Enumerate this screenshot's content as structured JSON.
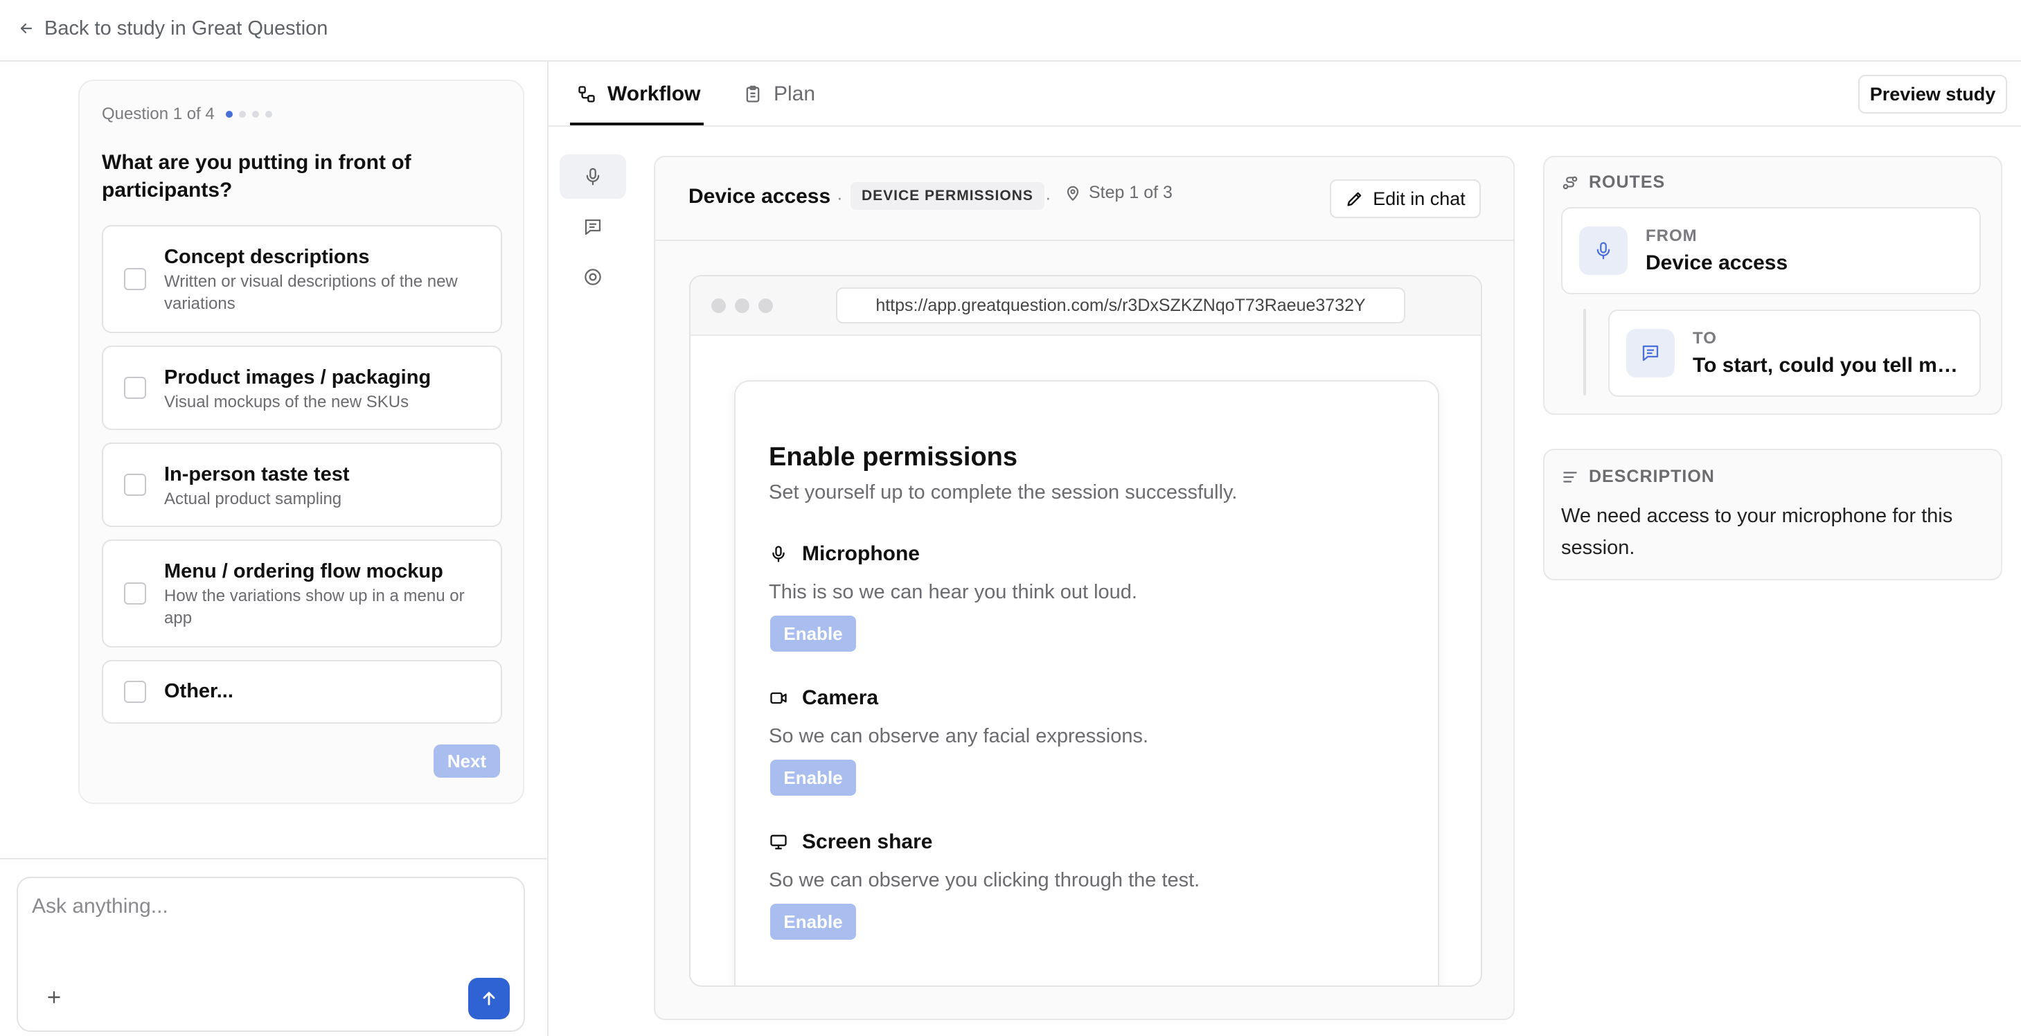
{
  "topbar": {
    "back_label": "Back to study in Great Question",
    "back_icon": "arrow-left-icon"
  },
  "question": {
    "meta": "Question 1 of 4",
    "progress_total": 4,
    "progress_current": 1,
    "text": "What are you putting in front of participants?",
    "options": [
      {
        "title": "Concept descriptions",
        "sub": "Written or visual descriptions of the new variations",
        "checked": false
      },
      {
        "title": "Product images / packaging",
        "sub": "Visual mockups of the new SKUs",
        "checked": false
      },
      {
        "title": "In-person taste test",
        "sub": "Actual product sampling",
        "checked": false
      },
      {
        "title": "Menu / ordering flow mockup",
        "sub": "How the variations show up in a menu or app",
        "checked": false
      },
      {
        "title": "Other...",
        "sub": "",
        "checked": false
      }
    ],
    "next_label": "Next"
  },
  "chat": {
    "placeholder": "Ask anything...",
    "plus_icon": "plus-icon",
    "send_icon": "arrow-up-icon"
  },
  "tabs": [
    {
      "label": "Workflow",
      "icon": "workflow-icon",
      "active": true
    },
    {
      "label": "Plan",
      "icon": "clipboard-icon",
      "active": false
    }
  ],
  "preview_label": "Preview study",
  "rail": [
    {
      "icon": "microphone-icon",
      "active": true
    },
    {
      "icon": "message-icon",
      "active": false
    },
    {
      "icon": "target-icon",
      "active": false
    }
  ],
  "step": {
    "title": "Device access",
    "badge": "DEVICE PERMISSIONS",
    "count": "Step 1 of 3",
    "count_icon": "map-pin-icon",
    "edit_label": "Edit in chat",
    "edit_icon": "pencil-icon"
  },
  "browser": {
    "url": "https://app.greatquestion.com/s/r3DxSZKZNqoT73Raeue3732Y"
  },
  "permissions": {
    "title": "Enable permissions",
    "subtitle": "Set yourself up to complete the session successfully.",
    "items": [
      {
        "title": "Microphone",
        "icon": "microphone-icon",
        "desc": "This is so we can hear you think out loud.",
        "button": "Enable"
      },
      {
        "title": "Camera",
        "icon": "video-camera-icon",
        "desc": "So we can observe any facial expressions.",
        "button": "Enable"
      },
      {
        "title": "Screen share",
        "icon": "monitor-icon",
        "desc": "So we can observe you clicking through the test.",
        "button": "Enable"
      }
    ]
  },
  "routes": {
    "label": "ROUTES",
    "icon": "route-icon",
    "from_label": "FROM",
    "from_value": "Device access",
    "to_label": "TO",
    "to_value": "To start, could you tell me ..."
  },
  "description": {
    "label": "DESCRIPTION",
    "icon": "align-left-icon",
    "text": "We need access to your microphone for this session."
  },
  "colors": {
    "accent": "#2f63d4",
    "disabled_button": "#a9bdee",
    "border": "#e8e8ea"
  }
}
